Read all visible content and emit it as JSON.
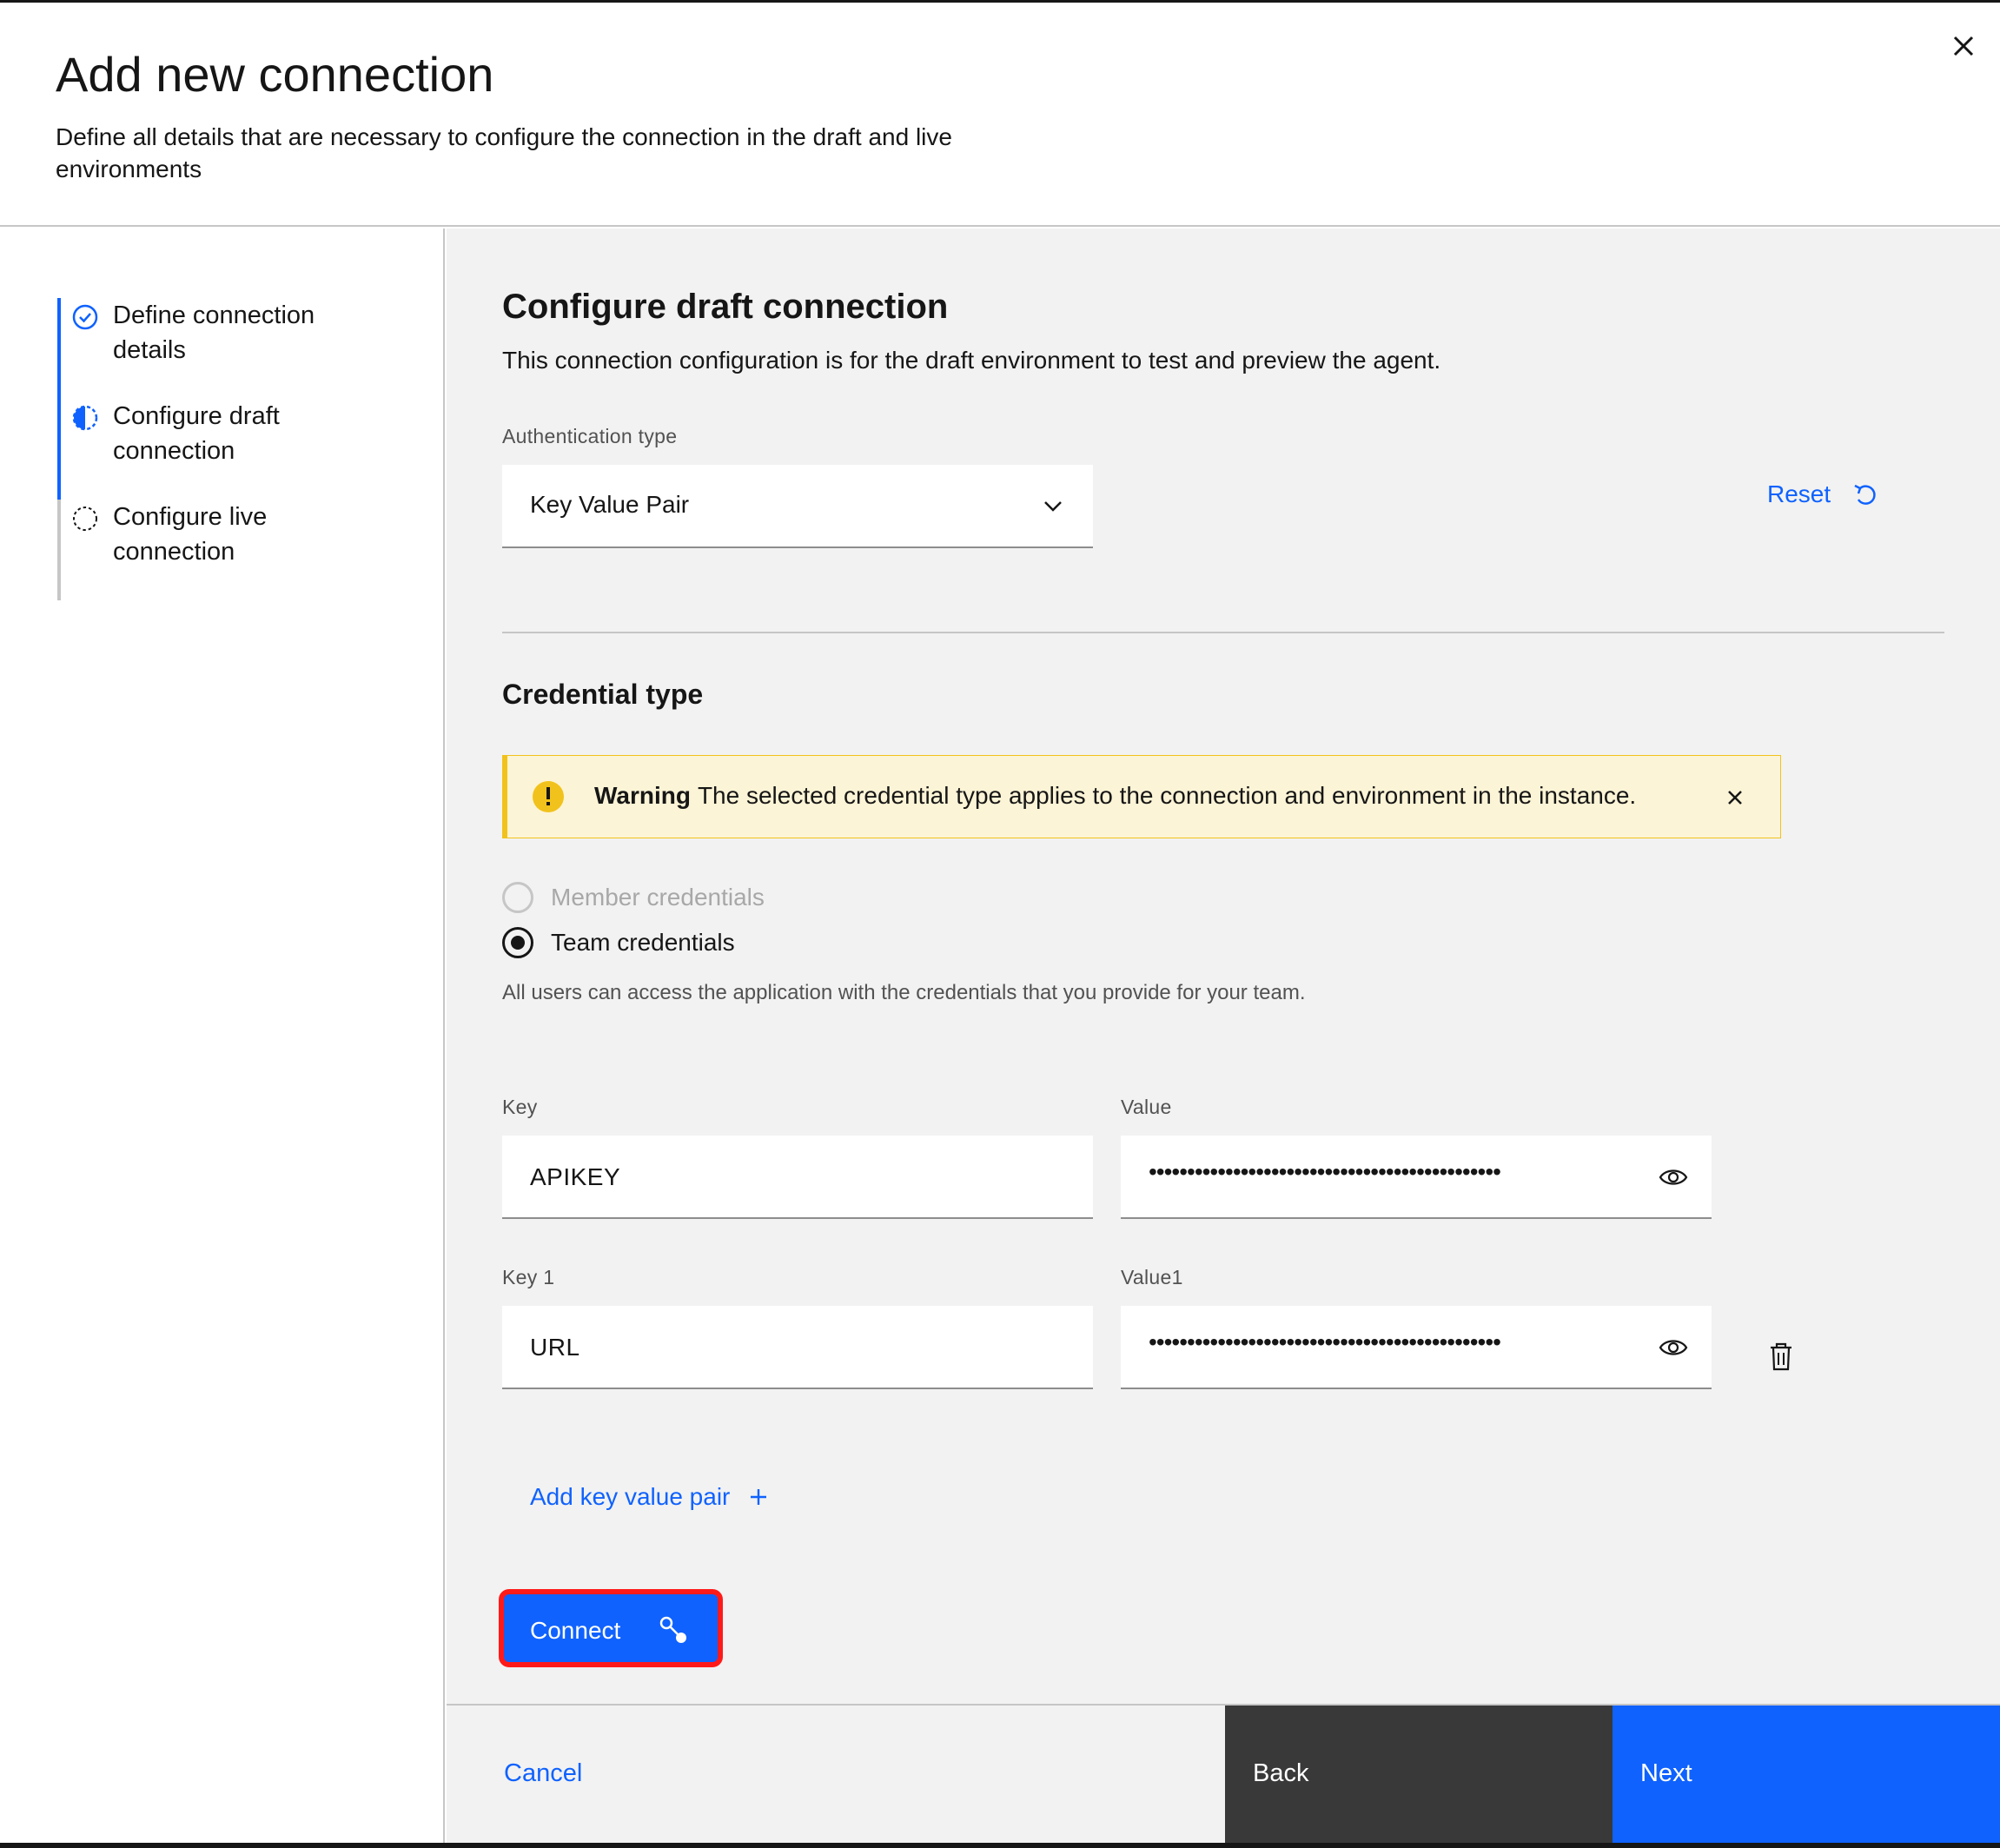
{
  "modal": {
    "title": "Add new connection",
    "subtitle": "Define all details that are necessary to configure the connection in the draft and live environments"
  },
  "steps": [
    {
      "label": "Define connection details",
      "status": "complete"
    },
    {
      "label": "Configure draft connection",
      "status": "current"
    },
    {
      "label": "Configure live connection",
      "status": "incomplete"
    }
  ],
  "section": {
    "title": "Configure draft connection",
    "description": "This connection configuration is for the draft environment to test and preview the agent."
  },
  "auth": {
    "label": "Authentication type",
    "value": "Key Value Pair",
    "reset_label": "Reset"
  },
  "credential": {
    "title": "Credential type",
    "warning_title": "Warning",
    "warning_text": "The selected credential type applies to the connection and environment in the instance.",
    "options": [
      {
        "label": "Member credentials",
        "selected": false,
        "disabled": true
      },
      {
        "label": "Team credentials",
        "selected": true,
        "disabled": false
      }
    ],
    "helper": "All users can access the application with the credentials that you provide for your team."
  },
  "pairs": [
    {
      "key_label": "Key",
      "key_value": "APIKEY",
      "value_label": "Value",
      "value_masked": "••••••••••••••••••••••••••••••••••••••••••••••"
    },
    {
      "key_label": "Key 1",
      "key_value": "URL",
      "value_label": "Value1",
      "value_masked": "••••••••••••••••••••••••••••••••••••••••••••••"
    }
  ],
  "actions": {
    "add_pair": "Add key value pair",
    "connect": "Connect",
    "cancel": "Cancel",
    "back": "Back",
    "next": "Next"
  },
  "colors": {
    "primary": "#0f62fe",
    "warning": "#f1c21b",
    "warning_bg": "#fcf4d6",
    "highlight": "#ff1a1a",
    "back_bg": "#393939"
  }
}
